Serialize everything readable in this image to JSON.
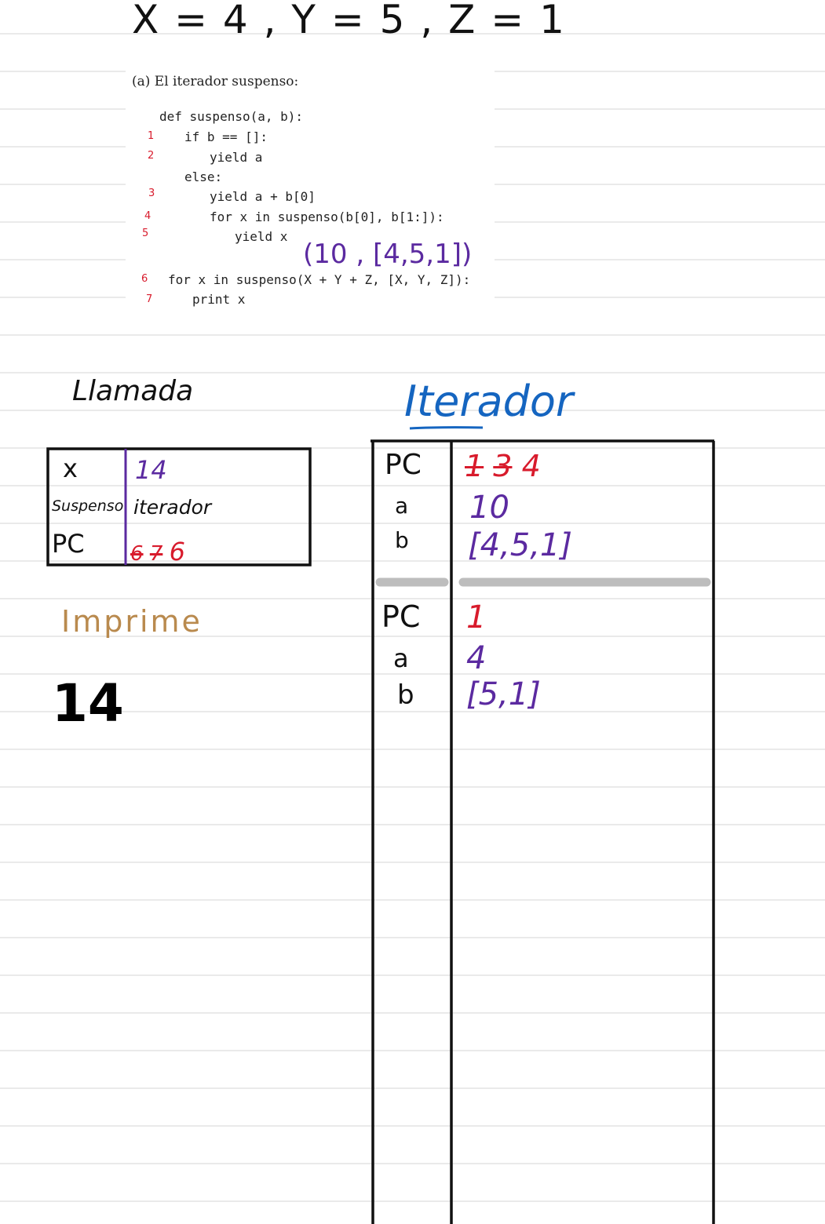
{
  "header": "X = 4 , Y = 5 , Z = 1",
  "exercise": {
    "title": "(a)  El iterador suspenso:",
    "code": [
      "def suspenso(a, b):",
      "if b == []:",
      "yield a",
      "else:",
      "yield a + b[0]",
      "for x in suspenso(b[0], b[1:]):",
      "yield x",
      "for x in suspenso(X + Y + Z, [X, Y, Z]):",
      "print x"
    ],
    "line_numbers": [
      "1",
      "2",
      "3",
      "4",
      "5",
      "6",
      "7"
    ],
    "annotation": "(10 , [4,5,1])"
  },
  "llamada": {
    "title": "Llamada",
    "rows": [
      {
        "label": "x",
        "value": "14"
      },
      {
        "label": "Suspenso",
        "value": "iterador"
      },
      {
        "label": "PC",
        "values": [
          "6",
          "7",
          "6"
        ]
      }
    ]
  },
  "iterador": {
    "title": "Iterador",
    "frames": [
      {
        "pc_label": "PC",
        "pc_values": [
          "1",
          "3",
          "4"
        ],
        "a_label": "a",
        "a_value": "10",
        "b_label": "b",
        "b_value": "[4,5,1]"
      },
      {
        "pc_label": "PC",
        "pc_values": [
          "1"
        ],
        "a_label": "a",
        "a_value": "4",
        "b_label": "b",
        "b_value": "[5,1]"
      }
    ]
  },
  "imprime": {
    "title": "Imprime",
    "output": "14"
  },
  "colors": {
    "rule": "#e0e0e0",
    "red": "#d81b2c",
    "purple": "#5b2aa0",
    "blue": "#1565c0",
    "gold": "#b98a4e",
    "divider": "#bdbdbd"
  }
}
